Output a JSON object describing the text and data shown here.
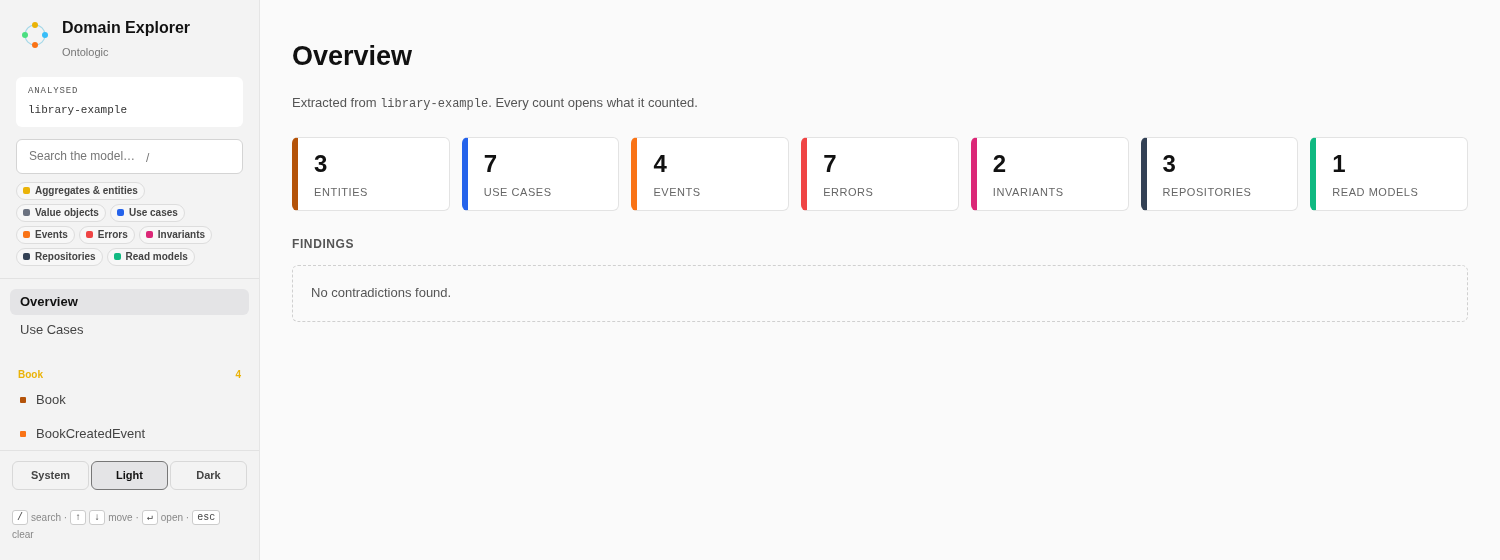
{
  "app": {
    "title": "Domain Explorer",
    "subtitle": "Ontologic"
  },
  "analysed": {
    "label": "ANALYSED",
    "value": "library-example"
  },
  "search": {
    "placeholder": "Search the model…",
    "shortcut": "/"
  },
  "legend": [
    {
      "label": "Aggregates & entities",
      "color": "#eab308"
    },
    {
      "label": "Value objects",
      "color": "#6b7280"
    },
    {
      "label": "Use cases",
      "color": "#2563eb"
    },
    {
      "label": "Events",
      "color": "#f97316"
    },
    {
      "label": "Errors",
      "color": "#ef4444"
    },
    {
      "label": "Invariants",
      "color": "#db2777"
    },
    {
      "label": "Repositories",
      "color": "#334155"
    },
    {
      "label": "Read models",
      "color": "#10b981"
    }
  ],
  "nav": [
    {
      "label": "Overview",
      "selected": true
    },
    {
      "label": "Use Cases",
      "selected": false
    }
  ],
  "group": {
    "title": "Book",
    "count": "4",
    "items": [
      {
        "label": "Book",
        "color": "#b45309"
      },
      {
        "label": "BookCreatedEvent",
        "color": "#f97316"
      }
    ]
  },
  "theme": [
    {
      "label": "System",
      "selected": false
    },
    {
      "label": "Light",
      "selected": true
    },
    {
      "label": "Dark",
      "selected": false
    }
  ],
  "hints": [
    {
      "kind": "key",
      "text": "/"
    },
    {
      "kind": "text",
      "text": "search ·"
    },
    {
      "kind": "key",
      "text": "↑"
    },
    {
      "kind": "key",
      "text": "↓"
    },
    {
      "kind": "text",
      "text": "move ·"
    },
    {
      "kind": "key",
      "text": "↵"
    },
    {
      "kind": "text",
      "text": "open ·"
    },
    {
      "kind": "key",
      "text": "esc"
    },
    {
      "kind": "text",
      "text": "clear"
    }
  ],
  "page": {
    "title": "Overview",
    "description": {
      "before": "Extracted from",
      "code": "library-example",
      "after": ". Every count opens what it counted."
    }
  },
  "stats": [
    {
      "value": "3",
      "label": "ENTITIES",
      "color": "#b45309"
    },
    {
      "value": "7",
      "label": "USE CASES",
      "color": "#2563eb"
    },
    {
      "value": "4",
      "label": "EVENTS",
      "color": "#f97316"
    },
    {
      "value": "7",
      "label": "ERRORS",
      "color": "#ef4444"
    },
    {
      "value": "2",
      "label": "INVARIANTS",
      "color": "#db2777"
    },
    {
      "value": "3",
      "label": "REPOSITORIES",
      "color": "#334155"
    },
    {
      "value": "1",
      "label": "READ MODELS",
      "color": "#10b981"
    }
  ],
  "findings": {
    "title": "FINDINGS",
    "message": "No contradictions found."
  }
}
